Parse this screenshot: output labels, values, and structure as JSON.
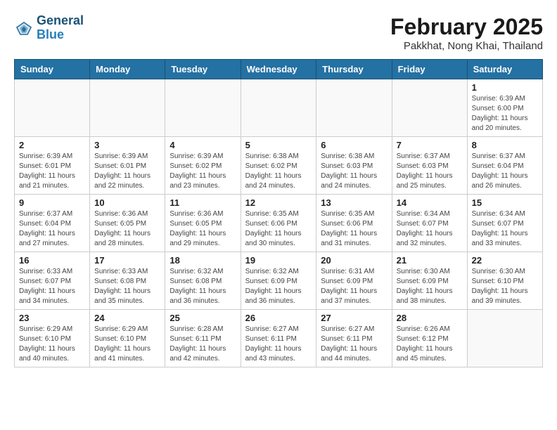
{
  "header": {
    "logo_line1": "General",
    "logo_line2": "Blue",
    "main_title": "February 2025",
    "sub_title": "Pakkhat, Nong Khai, Thailand"
  },
  "weekdays": [
    "Sunday",
    "Monday",
    "Tuesday",
    "Wednesday",
    "Thursday",
    "Friday",
    "Saturday"
  ],
  "weeks": [
    [
      {
        "day": "",
        "info": ""
      },
      {
        "day": "",
        "info": ""
      },
      {
        "day": "",
        "info": ""
      },
      {
        "day": "",
        "info": ""
      },
      {
        "day": "",
        "info": ""
      },
      {
        "day": "",
        "info": ""
      },
      {
        "day": "1",
        "info": "Sunrise: 6:39 AM\nSunset: 6:00 PM\nDaylight: 11 hours\nand 20 minutes."
      }
    ],
    [
      {
        "day": "2",
        "info": "Sunrise: 6:39 AM\nSunset: 6:01 PM\nDaylight: 11 hours\nand 21 minutes."
      },
      {
        "day": "3",
        "info": "Sunrise: 6:39 AM\nSunset: 6:01 PM\nDaylight: 11 hours\nand 22 minutes."
      },
      {
        "day": "4",
        "info": "Sunrise: 6:39 AM\nSunset: 6:02 PM\nDaylight: 11 hours\nand 23 minutes."
      },
      {
        "day": "5",
        "info": "Sunrise: 6:38 AM\nSunset: 6:02 PM\nDaylight: 11 hours\nand 24 minutes."
      },
      {
        "day": "6",
        "info": "Sunrise: 6:38 AM\nSunset: 6:03 PM\nDaylight: 11 hours\nand 24 minutes."
      },
      {
        "day": "7",
        "info": "Sunrise: 6:37 AM\nSunset: 6:03 PM\nDaylight: 11 hours\nand 25 minutes."
      },
      {
        "day": "8",
        "info": "Sunrise: 6:37 AM\nSunset: 6:04 PM\nDaylight: 11 hours\nand 26 minutes."
      }
    ],
    [
      {
        "day": "9",
        "info": "Sunrise: 6:37 AM\nSunset: 6:04 PM\nDaylight: 11 hours\nand 27 minutes."
      },
      {
        "day": "10",
        "info": "Sunrise: 6:36 AM\nSunset: 6:05 PM\nDaylight: 11 hours\nand 28 minutes."
      },
      {
        "day": "11",
        "info": "Sunrise: 6:36 AM\nSunset: 6:05 PM\nDaylight: 11 hours\nand 29 minutes."
      },
      {
        "day": "12",
        "info": "Sunrise: 6:35 AM\nSunset: 6:06 PM\nDaylight: 11 hours\nand 30 minutes."
      },
      {
        "day": "13",
        "info": "Sunrise: 6:35 AM\nSunset: 6:06 PM\nDaylight: 11 hours\nand 31 minutes."
      },
      {
        "day": "14",
        "info": "Sunrise: 6:34 AM\nSunset: 6:07 PM\nDaylight: 11 hours\nand 32 minutes."
      },
      {
        "day": "15",
        "info": "Sunrise: 6:34 AM\nSunset: 6:07 PM\nDaylight: 11 hours\nand 33 minutes."
      }
    ],
    [
      {
        "day": "16",
        "info": "Sunrise: 6:33 AM\nSunset: 6:07 PM\nDaylight: 11 hours\nand 34 minutes."
      },
      {
        "day": "17",
        "info": "Sunrise: 6:33 AM\nSunset: 6:08 PM\nDaylight: 11 hours\nand 35 minutes."
      },
      {
        "day": "18",
        "info": "Sunrise: 6:32 AM\nSunset: 6:08 PM\nDaylight: 11 hours\nand 36 minutes."
      },
      {
        "day": "19",
        "info": "Sunrise: 6:32 AM\nSunset: 6:09 PM\nDaylight: 11 hours\nand 36 minutes."
      },
      {
        "day": "20",
        "info": "Sunrise: 6:31 AM\nSunset: 6:09 PM\nDaylight: 11 hours\nand 37 minutes."
      },
      {
        "day": "21",
        "info": "Sunrise: 6:30 AM\nSunset: 6:09 PM\nDaylight: 11 hours\nand 38 minutes."
      },
      {
        "day": "22",
        "info": "Sunrise: 6:30 AM\nSunset: 6:10 PM\nDaylight: 11 hours\nand 39 minutes."
      }
    ],
    [
      {
        "day": "23",
        "info": "Sunrise: 6:29 AM\nSunset: 6:10 PM\nDaylight: 11 hours\nand 40 minutes."
      },
      {
        "day": "24",
        "info": "Sunrise: 6:29 AM\nSunset: 6:10 PM\nDaylight: 11 hours\nand 41 minutes."
      },
      {
        "day": "25",
        "info": "Sunrise: 6:28 AM\nSunset: 6:11 PM\nDaylight: 11 hours\nand 42 minutes."
      },
      {
        "day": "26",
        "info": "Sunrise: 6:27 AM\nSunset: 6:11 PM\nDaylight: 11 hours\nand 43 minutes."
      },
      {
        "day": "27",
        "info": "Sunrise: 6:27 AM\nSunset: 6:11 PM\nDaylight: 11 hours\nand 44 minutes."
      },
      {
        "day": "28",
        "info": "Sunrise: 6:26 AM\nSunset: 6:12 PM\nDaylight: 11 hours\nand 45 minutes."
      },
      {
        "day": "",
        "info": ""
      }
    ]
  ]
}
